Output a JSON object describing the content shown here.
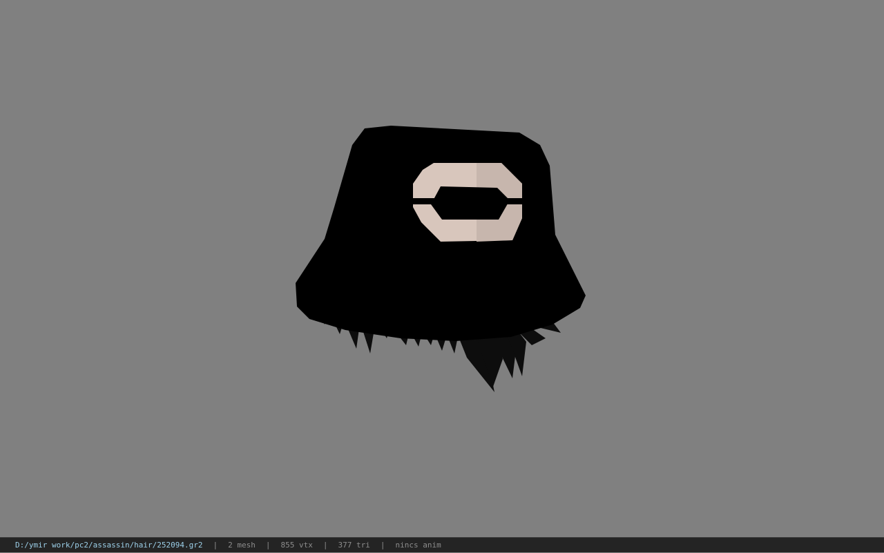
{
  "viewport": {
    "background": "#808080",
    "model": {
      "name": "bucket-hat-with-hair",
      "hat_color": "#000000",
      "emblem_color": "#d8c6bc",
      "hair_color": "#111111"
    }
  },
  "status": {
    "file_path": "D:/ymir work/pc2/assassin/hair/252094.gr2",
    "separator": "|",
    "mesh": "2 mesh",
    "vtx": "855 vtx",
    "tri": "377 tri",
    "anim": "nincs anim"
  }
}
